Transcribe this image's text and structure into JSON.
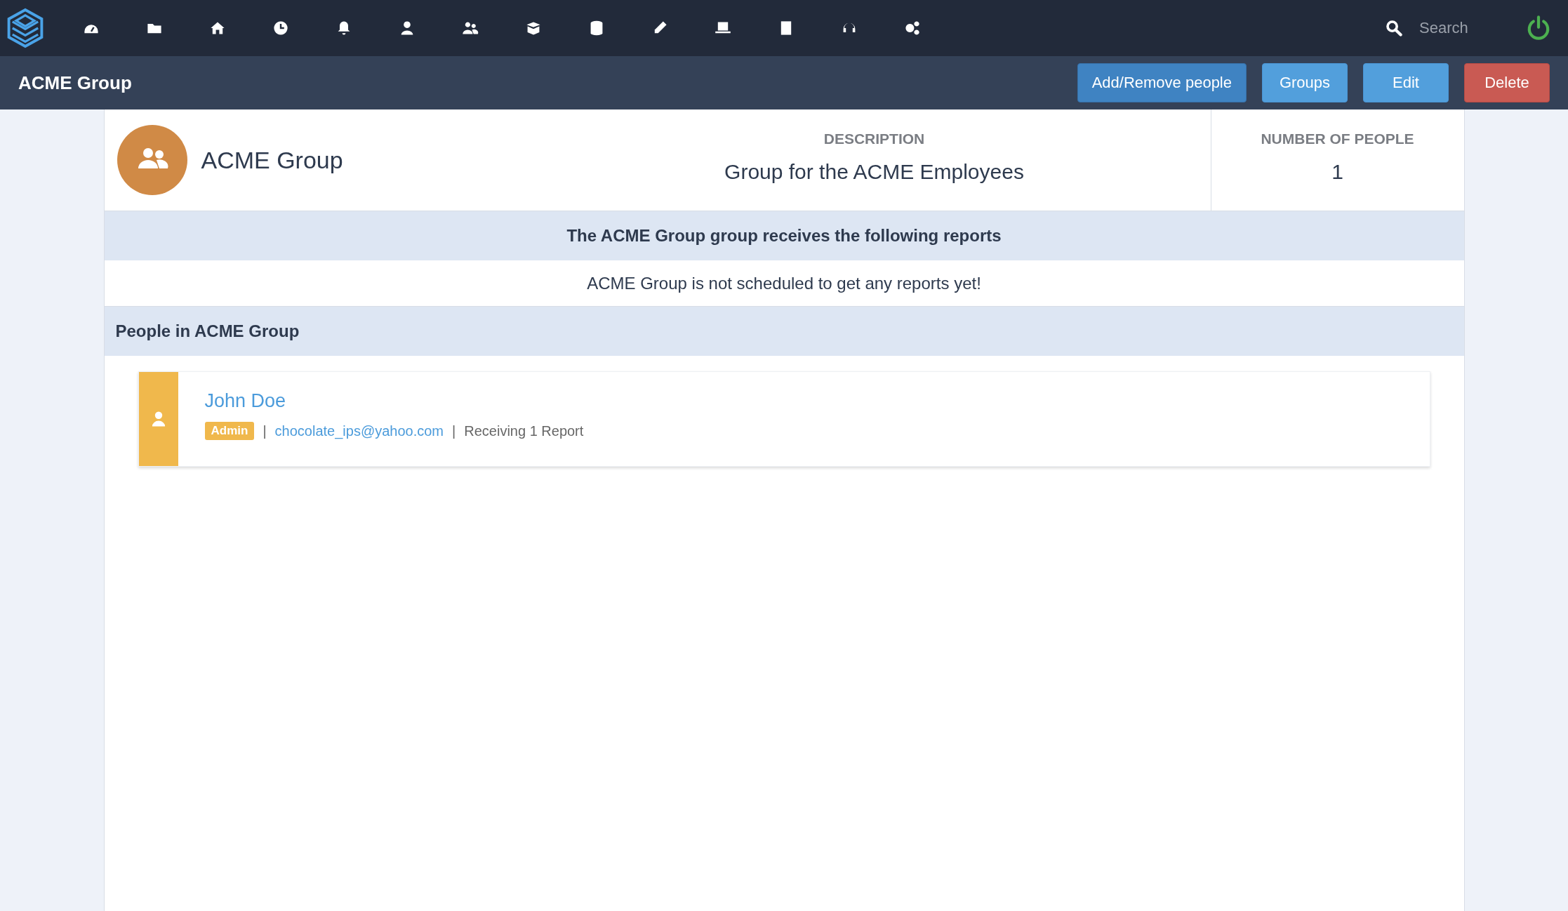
{
  "topbar": {
    "search": {
      "placeholder": "Search"
    }
  },
  "page_header": {
    "title": "ACME Group",
    "buttons": [
      {
        "label": "Add/Remove people",
        "kind": "primary-dark"
      },
      {
        "label": "Groups",
        "kind": "primary"
      },
      {
        "label": "Edit",
        "kind": "primary"
      },
      {
        "label": "Delete",
        "kind": "danger"
      }
    ]
  },
  "group": {
    "name": "ACME Group",
    "description_label": "DESCRIPTION",
    "description": "Group for the ACME Employees",
    "count_label": "NUMBER OF PEOPLE",
    "count": "1"
  },
  "reports": {
    "heading": "The ACME Group group receives the following reports",
    "message": "ACME Group is not scheduled to get any reports yet!"
  },
  "people": {
    "heading": "People in ACME Group",
    "items": [
      {
        "name": "John Doe",
        "role": "Admin",
        "separator_1": "|",
        "email": "chocolate_ips@yahoo.com",
        "separator_2": "|",
        "reports": "Receiving 1 Report"
      }
    ]
  }
}
